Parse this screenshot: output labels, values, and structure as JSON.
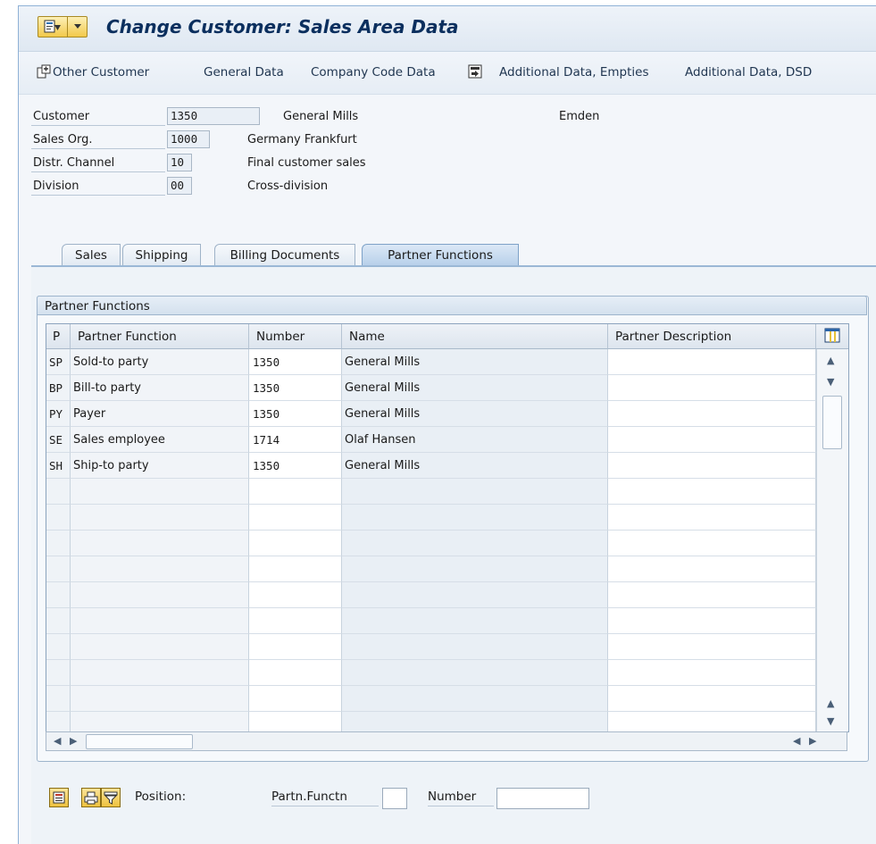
{
  "window": {
    "title": "Change Customer: Sales Area Data"
  },
  "toolbar": {
    "items": [
      "Other Customer",
      "General Data",
      "Company Code Data",
      "Additional Data, Empties",
      "Additional Data, DSD"
    ]
  },
  "header": {
    "customer": {
      "label": "Customer",
      "value": "1350",
      "name": "General Mills",
      "city": "Emden"
    },
    "sales_org": {
      "label": "Sales Org.",
      "value": "1000",
      "desc": "Germany Frankfurt"
    },
    "distr_channel": {
      "label": "Distr. Channel",
      "value": "10",
      "desc": "Final customer sales"
    },
    "division": {
      "label": "Division",
      "value": "00",
      "desc": "Cross-division"
    }
  },
  "tabs": [
    {
      "label": "Sales",
      "active": false
    },
    {
      "label": "Shipping",
      "active": false
    },
    {
      "label": "Billing Documents",
      "active": false
    },
    {
      "label": "Partner Functions",
      "active": true
    }
  ],
  "group": {
    "title": "Partner Functions"
  },
  "table": {
    "columns": [
      "P",
      "Partner Function",
      "Number",
      "Name",
      "Partner Description"
    ],
    "rows": [
      {
        "p": "SP",
        "function": "Sold-to party",
        "number": "1350",
        "name": "General Mills",
        "desc": ""
      },
      {
        "p": "BP",
        "function": "Bill-to party",
        "number": "1350",
        "name": "General Mills",
        "desc": ""
      },
      {
        "p": "PY",
        "function": "Payer",
        "number": "1350",
        "name": "General Mills",
        "desc": ""
      },
      {
        "p": "SE",
        "function": "Sales employee",
        "number": "1714",
        "name": "Olaf Hansen",
        "desc": ""
      },
      {
        "p": "SH",
        "function": "Ship-to party",
        "number": "1350",
        "name": "General Mills",
        "desc": ""
      }
    ]
  },
  "bottom": {
    "position_label": "Position:",
    "partn_functn_label": "Partn.Functn",
    "partn_functn_value": "",
    "number_label": "Number",
    "number_value": ""
  }
}
